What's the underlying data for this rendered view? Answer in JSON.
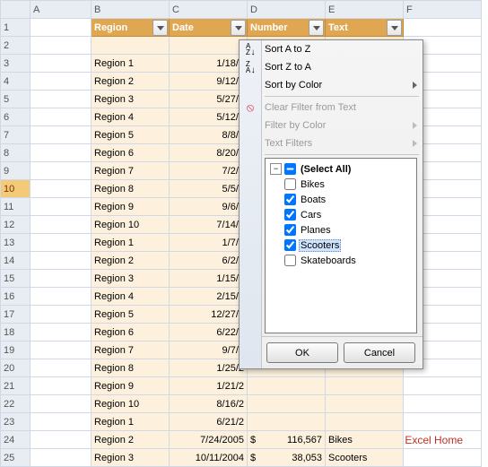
{
  "col_labels": [
    "A",
    "B",
    "C",
    "D",
    "E",
    "F"
  ],
  "row_labels": [
    "1",
    "2",
    "3",
    "4",
    "5",
    "6",
    "7",
    "8",
    "9",
    "10",
    "11",
    "12",
    "13",
    "14",
    "15",
    "16",
    "17",
    "18",
    "19",
    "20",
    "21",
    "22",
    "23",
    "24",
    "25"
  ],
  "selected_row": 10,
  "headers": {
    "region": "Region",
    "date": "Date",
    "number": "Number",
    "text": "Text"
  },
  "rows": [
    {
      "region": "Region 1",
      "date": "1/18/2",
      "num_sym": "",
      "num": "",
      "text": ""
    },
    {
      "region": "Region 2",
      "date": "9/12/2",
      "num_sym": "",
      "num": "",
      "text": ""
    },
    {
      "region": "Region 3",
      "date": "5/27/2",
      "num_sym": "",
      "num": "",
      "text": ""
    },
    {
      "region": "Region 4",
      "date": "5/12/2",
      "num_sym": "",
      "num": "",
      "text": ""
    },
    {
      "region": "Region 5",
      "date": "8/8/2",
      "num_sym": "",
      "num": "",
      "text": ""
    },
    {
      "region": "Region 6",
      "date": "8/20/2",
      "num_sym": "",
      "num": "",
      "text": ""
    },
    {
      "region": "Region 7",
      "date": "7/2/2",
      "num_sym": "",
      "num": "",
      "text": ""
    },
    {
      "region": "Region 8",
      "date": "5/5/2",
      "num_sym": "",
      "num": "",
      "text": ""
    },
    {
      "region": "Region 9",
      "date": "9/6/2",
      "num_sym": "",
      "num": "",
      "text": ""
    },
    {
      "region": "Region 10",
      "date": "7/14/2",
      "num_sym": "",
      "num": "",
      "text": ""
    },
    {
      "region": "Region 1",
      "date": "1/7/2",
      "num_sym": "",
      "num": "",
      "text": ""
    },
    {
      "region": "Region 2",
      "date": "6/2/2",
      "num_sym": "",
      "num": "",
      "text": ""
    },
    {
      "region": "Region 3",
      "date": "1/15/2",
      "num_sym": "",
      "num": "",
      "text": ""
    },
    {
      "region": "Region 4",
      "date": "2/15/2",
      "num_sym": "",
      "num": "",
      "text": ""
    },
    {
      "region": "Region 5",
      "date": "12/27/2",
      "num_sym": "",
      "num": "",
      "text": ""
    },
    {
      "region": "Region 6",
      "date": "6/22/2",
      "num_sym": "",
      "num": "",
      "text": ""
    },
    {
      "region": "Region 7",
      "date": "9/7/2",
      "num_sym": "",
      "num": "",
      "text": ""
    },
    {
      "region": "Region 8",
      "date": "1/25/2",
      "num_sym": "",
      "num": "",
      "text": ""
    },
    {
      "region": "Region 9",
      "date": "1/21/2",
      "num_sym": "",
      "num": "",
      "text": ""
    },
    {
      "region": "Region 10",
      "date": "8/16/2",
      "num_sym": "",
      "num": "",
      "text": ""
    },
    {
      "region": "Region 1",
      "date": "6/21/2",
      "num_sym": "",
      "num": "",
      "text": ""
    },
    {
      "region": "Region 2",
      "date": "7/24/2005",
      "num_sym": "$",
      "num": "116,567",
      "text": "Bikes"
    },
    {
      "region": "Region 3",
      "date": "10/11/2004",
      "num_sym": "$",
      "num": "38,053",
      "text": "Scooters"
    }
  ],
  "popup": {
    "sort_az": "Sort A to Z",
    "sort_za": "Sort Z to A",
    "sort_color": "Sort by Color",
    "clear": "Clear Filter from Text",
    "filter_color": "Filter by Color",
    "text_filters": "Text Filters",
    "select_all": "(Select All)",
    "items": [
      {
        "label": "Bikes",
        "checked": false
      },
      {
        "label": "Boats",
        "checked": true
      },
      {
        "label": "Cars",
        "checked": true
      },
      {
        "label": "Planes",
        "checked": true
      },
      {
        "label": "Scooters",
        "checked": true,
        "selected": true
      },
      {
        "label": "Skateboards",
        "checked": false
      }
    ],
    "ok": "OK",
    "cancel": "Cancel"
  },
  "watermark": "Excel Home"
}
